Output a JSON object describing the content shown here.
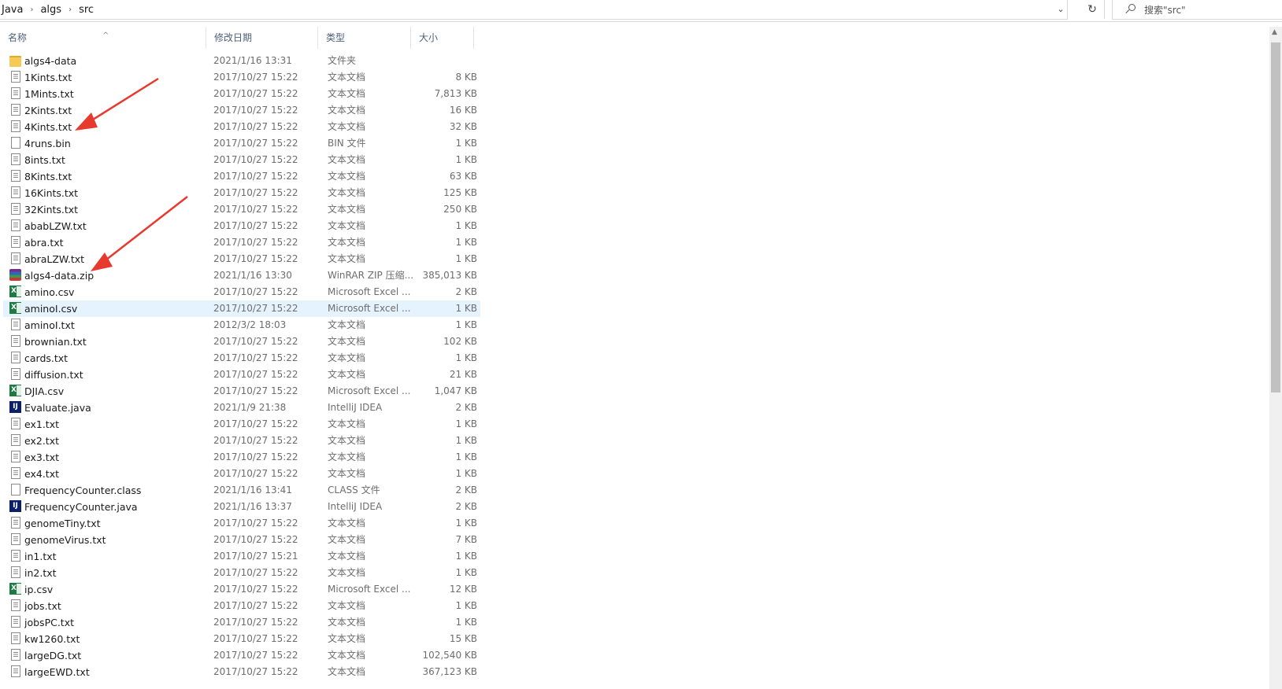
{
  "address_bar": {
    "crumbs": [
      "Java",
      "algs",
      "src"
    ],
    "dropdown_icon": "chevron-down-icon",
    "refresh_icon": "refresh-icon",
    "search_placeholder": "搜索\"src\""
  },
  "columns": {
    "name": "名称",
    "date": "修改日期",
    "type": "类型",
    "size": "大小"
  },
  "accent_colors": {
    "selected_row": "#e5f3ff",
    "annotation_arrow": "#e8392f"
  },
  "files": [
    {
      "name": "algs4-data",
      "date": "2021/1/16 13:31",
      "type": "文件夹",
      "size": "",
      "icon": "folder"
    },
    {
      "name": "1Kints.txt",
      "date": "2017/10/27 15:22",
      "type": "文本文档",
      "size": "8 KB",
      "icon": "doc"
    },
    {
      "name": "1Mints.txt",
      "date": "2017/10/27 15:22",
      "type": "文本文档",
      "size": "7,813 KB",
      "icon": "doc"
    },
    {
      "name": "2Kints.txt",
      "date": "2017/10/27 15:22",
      "type": "文本文档",
      "size": "16 KB",
      "icon": "doc"
    },
    {
      "name": "4Kints.txt",
      "date": "2017/10/27 15:22",
      "type": "文本文档",
      "size": "32 KB",
      "icon": "doc"
    },
    {
      "name": "4runs.bin",
      "date": "2017/10/27 15:22",
      "type": "BIN 文件",
      "size": "1 KB",
      "icon": "blank"
    },
    {
      "name": "8ints.txt",
      "date": "2017/10/27 15:22",
      "type": "文本文档",
      "size": "1 KB",
      "icon": "doc"
    },
    {
      "name": "8Kints.txt",
      "date": "2017/10/27 15:22",
      "type": "文本文档",
      "size": "63 KB",
      "icon": "doc"
    },
    {
      "name": "16Kints.txt",
      "date": "2017/10/27 15:22",
      "type": "文本文档",
      "size": "125 KB",
      "icon": "doc"
    },
    {
      "name": "32Kints.txt",
      "date": "2017/10/27 15:22",
      "type": "文本文档",
      "size": "250 KB",
      "icon": "doc"
    },
    {
      "name": "ababLZW.txt",
      "date": "2017/10/27 15:22",
      "type": "文本文档",
      "size": "1 KB",
      "icon": "doc"
    },
    {
      "name": "abra.txt",
      "date": "2017/10/27 15:22",
      "type": "文本文档",
      "size": "1 KB",
      "icon": "doc"
    },
    {
      "name": "abraLZW.txt",
      "date": "2017/10/27 15:22",
      "type": "文本文档",
      "size": "1 KB",
      "icon": "doc"
    },
    {
      "name": "algs4-data.zip",
      "date": "2021/1/16 13:30",
      "type": "WinRAR ZIP 压缩...",
      "size": "385,013 KB",
      "icon": "zip"
    },
    {
      "name": "amino.csv",
      "date": "2017/10/27 15:22",
      "type": "Microsoft Excel ...",
      "size": "2 KB",
      "icon": "excel"
    },
    {
      "name": "aminoI.csv",
      "date": "2017/10/27 15:22",
      "type": "Microsoft Excel ...",
      "size": "1 KB",
      "icon": "excel",
      "selected": true
    },
    {
      "name": "aminoI.txt",
      "date": "2012/3/2 18:03",
      "type": "文本文档",
      "size": "1 KB",
      "icon": "doc"
    },
    {
      "name": "brownian.txt",
      "date": "2017/10/27 15:22",
      "type": "文本文档",
      "size": "102 KB",
      "icon": "doc"
    },
    {
      "name": "cards.txt",
      "date": "2017/10/27 15:22",
      "type": "文本文档",
      "size": "1 KB",
      "icon": "doc"
    },
    {
      "name": "diffusion.txt",
      "date": "2017/10/27 15:22",
      "type": "文本文档",
      "size": "21 KB",
      "icon": "doc"
    },
    {
      "name": "DJIA.csv",
      "date": "2017/10/27 15:22",
      "type": "Microsoft Excel ...",
      "size": "1,047 KB",
      "icon": "excel"
    },
    {
      "name": "Evaluate.java",
      "date": "2021/1/9 21:38",
      "type": "IntelliJ IDEA",
      "size": "2 KB",
      "icon": "idea"
    },
    {
      "name": "ex1.txt",
      "date": "2017/10/27 15:22",
      "type": "文本文档",
      "size": "1 KB",
      "icon": "doc"
    },
    {
      "name": "ex2.txt",
      "date": "2017/10/27 15:22",
      "type": "文本文档",
      "size": "1 KB",
      "icon": "doc"
    },
    {
      "name": "ex3.txt",
      "date": "2017/10/27 15:22",
      "type": "文本文档",
      "size": "1 KB",
      "icon": "doc"
    },
    {
      "name": "ex4.txt",
      "date": "2017/10/27 15:22",
      "type": "文本文档",
      "size": "1 KB",
      "icon": "doc"
    },
    {
      "name": "FrequencyCounter.class",
      "date": "2021/1/16 13:41",
      "type": "CLASS 文件",
      "size": "2 KB",
      "icon": "blank"
    },
    {
      "name": "FrequencyCounter.java",
      "date": "2021/1/16 13:37",
      "type": "IntelliJ IDEA",
      "size": "2 KB",
      "icon": "idea"
    },
    {
      "name": "genomeTiny.txt",
      "date": "2017/10/27 15:22",
      "type": "文本文档",
      "size": "1 KB",
      "icon": "doc"
    },
    {
      "name": "genomeVirus.txt",
      "date": "2017/10/27 15:22",
      "type": "文本文档",
      "size": "7 KB",
      "icon": "doc"
    },
    {
      "name": "in1.txt",
      "date": "2017/10/27 15:21",
      "type": "文本文档",
      "size": "1 KB",
      "icon": "doc"
    },
    {
      "name": "in2.txt",
      "date": "2017/10/27 15:22",
      "type": "文本文档",
      "size": "1 KB",
      "icon": "doc"
    },
    {
      "name": "ip.csv",
      "date": "2017/10/27 15:22",
      "type": "Microsoft Excel ...",
      "size": "12 KB",
      "icon": "excel"
    },
    {
      "name": "jobs.txt",
      "date": "2017/10/27 15:22",
      "type": "文本文档",
      "size": "1 KB",
      "icon": "doc"
    },
    {
      "name": "jobsPC.txt",
      "date": "2017/10/27 15:22",
      "type": "文本文档",
      "size": "1 KB",
      "icon": "doc"
    },
    {
      "name": "kw1260.txt",
      "date": "2017/10/27 15:22",
      "type": "文本文档",
      "size": "15 KB",
      "icon": "doc"
    },
    {
      "name": "largeDG.txt",
      "date": "2017/10/27 15:22",
      "type": "文本文档",
      "size": "102,540 KB",
      "icon": "doc"
    },
    {
      "name": "largeEWD.txt",
      "date": "2017/10/27 15:22",
      "type": "文本文档",
      "size": "367,123 KB",
      "icon": "doc"
    }
  ]
}
